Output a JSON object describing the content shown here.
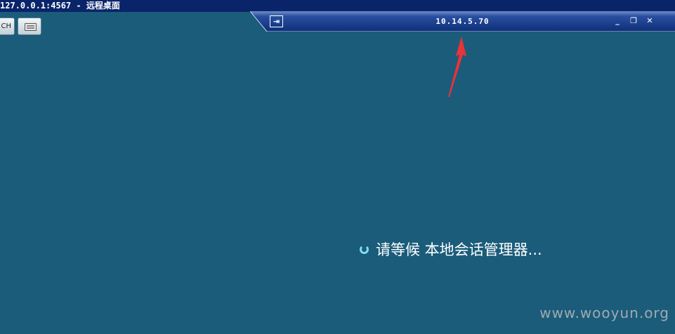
{
  "window": {
    "title": "127.0.0.1:4567 - 远程桌面"
  },
  "toolbar": {
    "lang_button_label": "CH",
    "keyboard_button_icon": "keyboard-icon"
  },
  "connection_bar": {
    "pin_icon": "pin-icon",
    "remote_ip": "10.14.5.70",
    "minimize_icon": "minimize-icon",
    "restore_icon": "restore-icon",
    "close_icon": "close-icon"
  },
  "session": {
    "status_text": "请等候 本地会话管理器..."
  },
  "watermark": "www.wooyun.org",
  "colors": {
    "desktop_background": "#1b5c7a",
    "titlebar": "#0a246a",
    "annotation_arrow": "#e8333a"
  }
}
